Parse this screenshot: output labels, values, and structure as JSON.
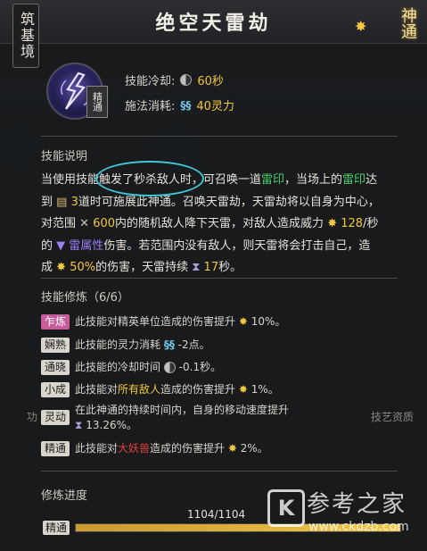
{
  "header": {
    "realm": "筑基境",
    "skill_name": "绝空天雷劫",
    "logo_text": "神通"
  },
  "skill": {
    "type_badge": "精通",
    "cooldown_label": "技能冷却:",
    "cooldown_value": "60秒",
    "cost_label": "施法消耗:",
    "cost_value": "40灵力"
  },
  "description": {
    "title": "技能说明",
    "line1_a": "当使用技能触发了秒杀敌人时，可召唤一道",
    "line1_b": "雷印",
    "line1_c": "，当场上的",
    "line1_d": "雷印",
    "line1_e": "达",
    "line2_a": "到",
    "line2_b": "3",
    "line2_c": "道时可施展此神通。召唤天雷劫，天雷劫将以自身为中心，",
    "line3_a": "对范围",
    "line3_b": "600",
    "line3_c": "内的随机敌人降下天雷，对敌人造成威力",
    "line3_d": "128",
    "line3_e": "/秒",
    "line4_a": "的",
    "line4_b": "雷属性",
    "line4_c": "伤害。若范围内没有敌人，则天雷将会打击自己，造",
    "line5_a": "成",
    "line5_b": "50%",
    "line5_c": "的伤害，天雷持续",
    "line5_d": "17",
    "line5_e": "秒。"
  },
  "mods": {
    "title": "技能修炼（6/6）",
    "items": [
      {
        "tag": "乍炼",
        "a": "此技能对精英单位造成的伤害提升",
        "b": "",
        "c": "",
        "value": "10%。"
      },
      {
        "tag": "娴熟",
        "a": "此技能的灵力消耗",
        "b": "",
        "c": "",
        "value": "-2点。"
      },
      {
        "tag": "通晓",
        "a": "此技能的冷却时间",
        "b": "",
        "c": "",
        "value": "-0.1秒。"
      },
      {
        "tag": "小成",
        "a": "此技能对",
        "b": "所有敌人",
        "c": "造成的伤害提升",
        "value": "1%。"
      },
      {
        "tag": "灵动",
        "a": "在此神通的持续时间内，自身的移动速度提升",
        "b": "",
        "c": "",
        "value": "13.26%。"
      },
      {
        "tag": "精通",
        "a": "此技能对",
        "b": "大妖兽",
        "c": "造成的伤害提升",
        "value": "2%。"
      }
    ]
  },
  "progress": {
    "title": "修炼进度",
    "value_text": "1104/1104",
    "fraction": 1.0,
    "level_tag": "精通"
  },
  "watermark": {
    "k": "K",
    "cn": "参考之家",
    "url": "www.ckdzb.com"
  },
  "background": {
    "left_label": "功",
    "right_label": "技艺资质"
  }
}
